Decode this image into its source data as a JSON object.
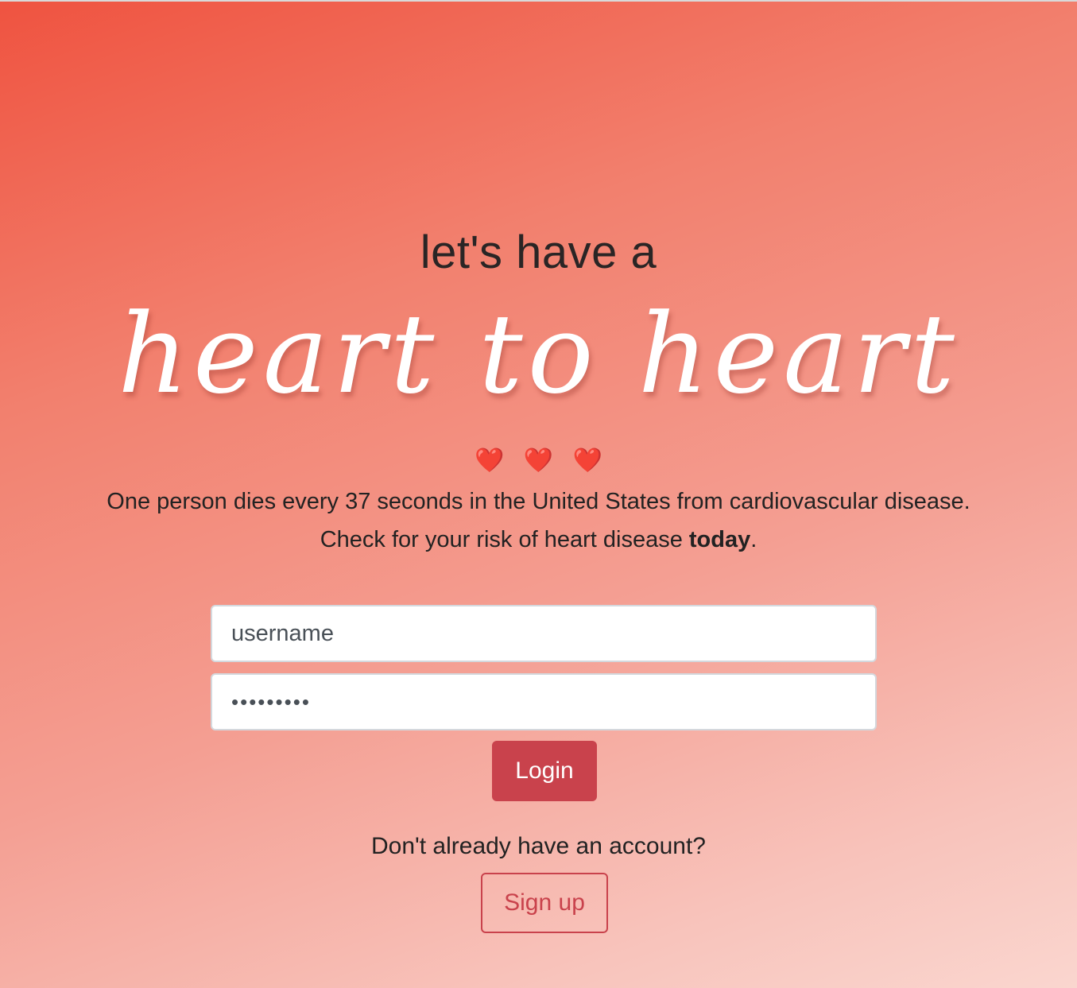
{
  "hero": {
    "tagline": "let's have a",
    "script_title": "heart to heart",
    "hearts": [
      "❤️",
      "❤️",
      "❤️"
    ]
  },
  "lead": {
    "line1": "One person dies every 37 seconds in the United States from cardiovascular disease.",
    "line2_prefix": "Check for your risk of heart disease ",
    "line2_bold": "today",
    "line2_suffix": "."
  },
  "login_form": {
    "username_value": "username",
    "password_value": "•••••••••",
    "login_label": "Login"
  },
  "signup": {
    "prompt": "Don't already have an account?",
    "button_label": "Sign up"
  },
  "colors": {
    "accent": "#c9424c",
    "gradient_start": "#ef5340",
    "gradient_end": "#fad6cf"
  }
}
